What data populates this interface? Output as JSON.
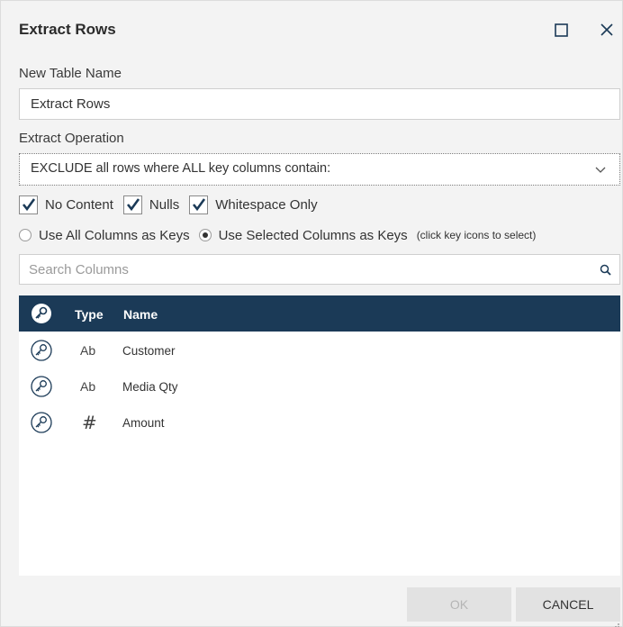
{
  "window": {
    "title": "Extract Rows"
  },
  "form": {
    "table_name_label": "New Table Name",
    "table_name_value": "Extract Rows",
    "operation_label": "Extract Operation",
    "operation_value": "EXCLUDE all rows where ALL key columns contain:"
  },
  "checkboxes": [
    {
      "label": "No Content",
      "checked": true
    },
    {
      "label": "Nulls",
      "checked": true
    },
    {
      "label": "Whitespace Only",
      "checked": true
    }
  ],
  "radios": [
    {
      "label": "Use All Columns as Keys",
      "selected": false
    },
    {
      "label": "Use Selected Columns as Keys",
      "selected": true
    }
  ],
  "radio_hint": "(click key icons to select)",
  "search": {
    "placeholder": "Search Columns"
  },
  "table": {
    "headers": {
      "type": "Type",
      "name": "Name"
    },
    "rows": [
      {
        "type": "Ab",
        "name": "Customer",
        "type_icon": "text-type"
      },
      {
        "type": "Ab",
        "name": "Media Qty",
        "type_icon": "text-type"
      },
      {
        "type": "#",
        "name": "Amount",
        "type_icon": "number-type"
      }
    ]
  },
  "buttons": {
    "ok": "OK",
    "cancel": "CANCEL"
  },
  "colors": {
    "header_bg": "#1b3a57",
    "dialog_bg": "#f3f3f3"
  }
}
